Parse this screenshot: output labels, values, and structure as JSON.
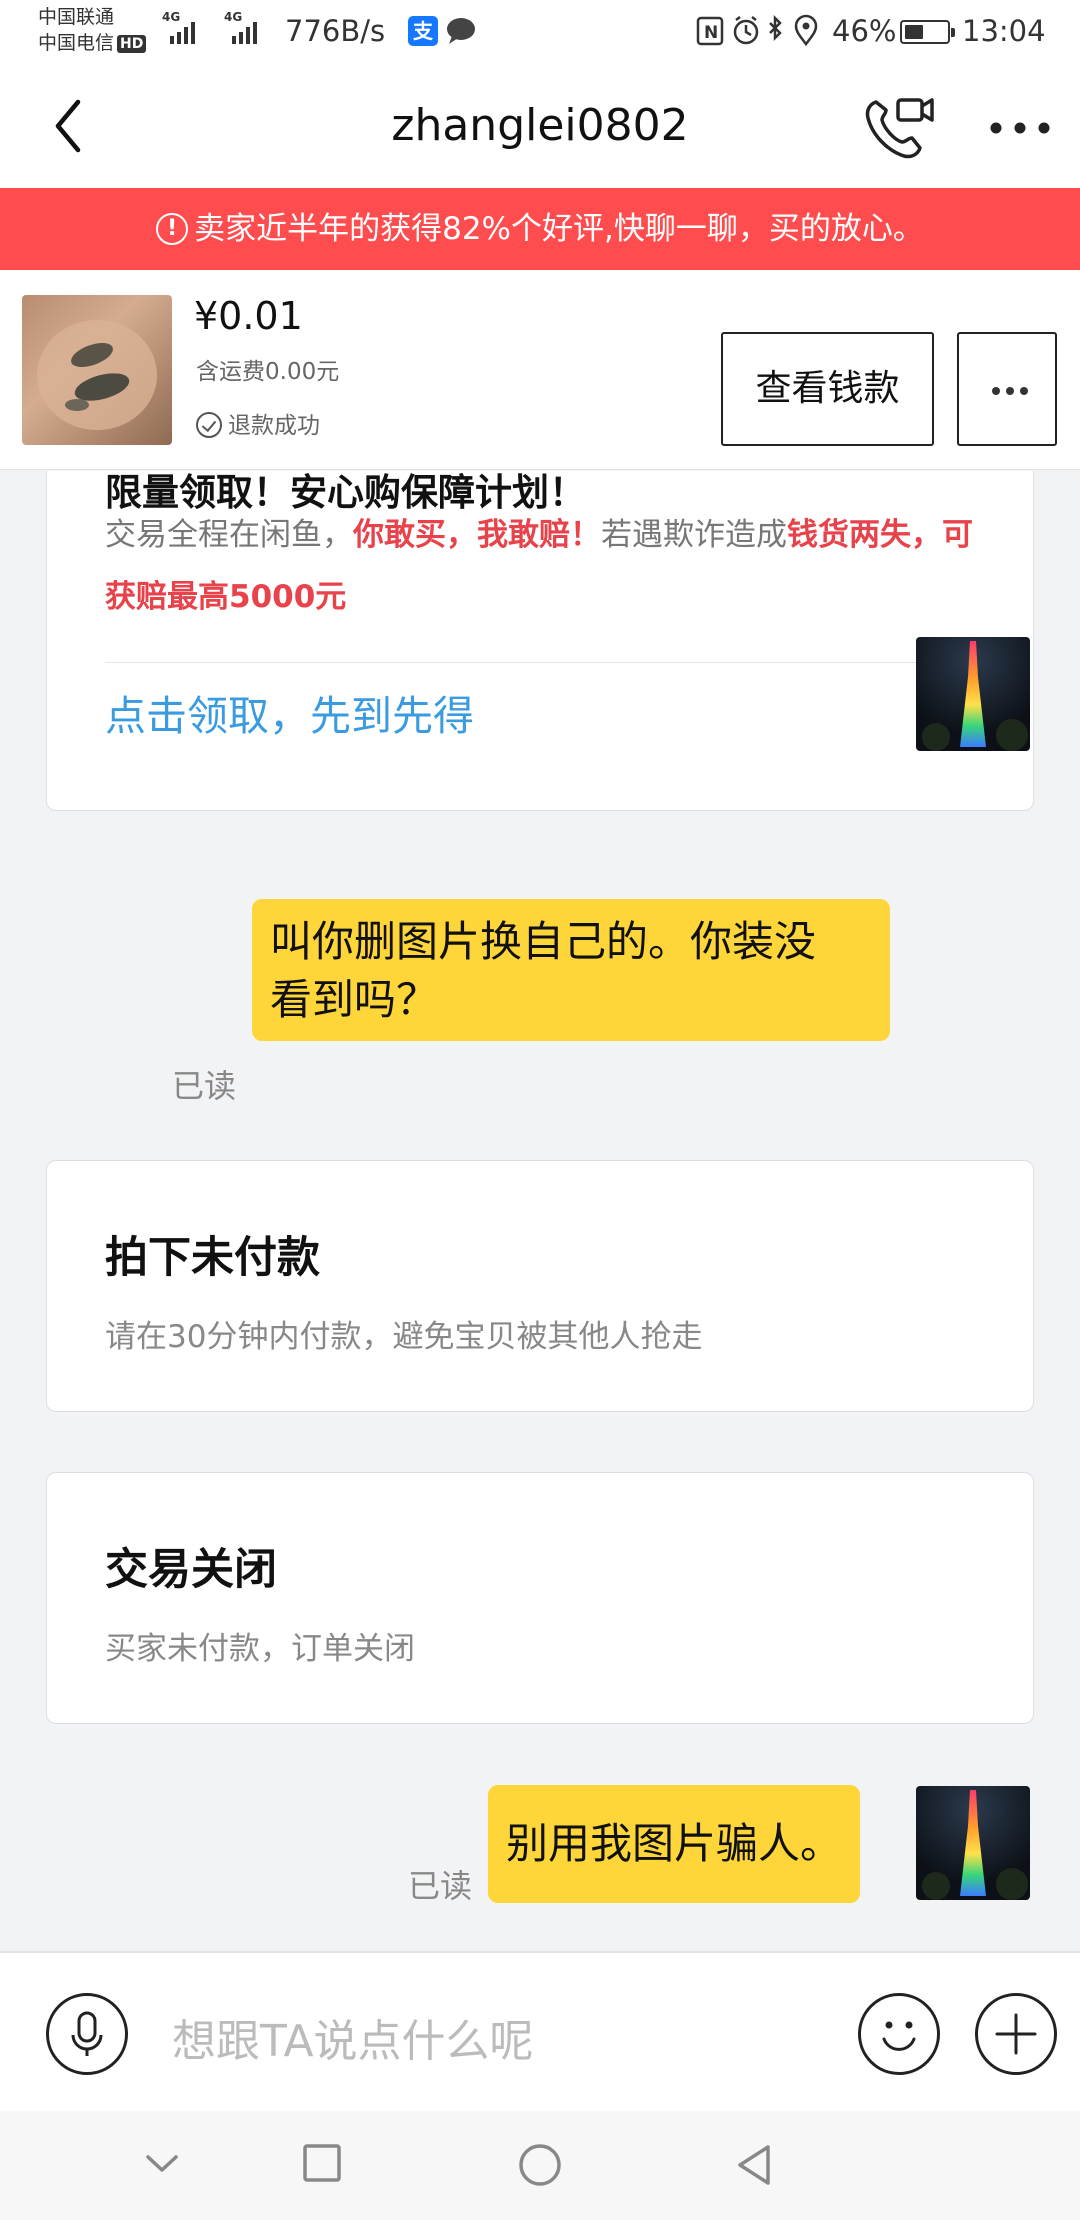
{
  "status_bar": {
    "carrier1": "中国联通",
    "carrier2": "中国电信",
    "hd": "HD",
    "sig1_label": "4G",
    "sig2_label": "4G",
    "speed": "776B/s",
    "alipay_glyph": "支",
    "battery_pct": "46%",
    "battery_level": 0.46,
    "time": "13:04"
  },
  "header": {
    "title": "zhanglei0802"
  },
  "banner": {
    "text": "卖家近半年的获得82%个好评,快聊一聊，买的放心。"
  },
  "product": {
    "price": "¥0.01",
    "shipping": "含运费0.00元",
    "status": "退款成功",
    "view_money_label": "查看钱款"
  },
  "messages": {
    "card1": {
      "heading": "限量领取！安心购保障计划！",
      "body_pre": "交易全程在闲鱼，",
      "body_red1": "你敢买，我敢赔！",
      "body_mid": "若遇欺诈造成",
      "body_red2": "钱货两失，可获赔最高5000元",
      "claim": "点击领取，先到先得"
    },
    "bubble1": {
      "line1": "叫你删图片换自己的。你装没",
      "line2": "看到吗？",
      "read": "已读"
    },
    "card2": {
      "title": "拍下未付款",
      "sub": "请在30分钟内付款，避免宝贝被其他人抢走"
    },
    "card3": {
      "title": "交易关闭",
      "sub": "买家未付款，订单关闭"
    },
    "bubble2": {
      "text": "别用我图片骗人。",
      "read": "已读"
    }
  },
  "input_bar": {
    "placeholder": "想跟TA说点什么呢"
  },
  "colors": {
    "banner_red": "#ff4d4f",
    "bubble_yellow": "#ffd63a",
    "link_blue": "#3a9be0",
    "highlight_red": "#e8424a"
  }
}
